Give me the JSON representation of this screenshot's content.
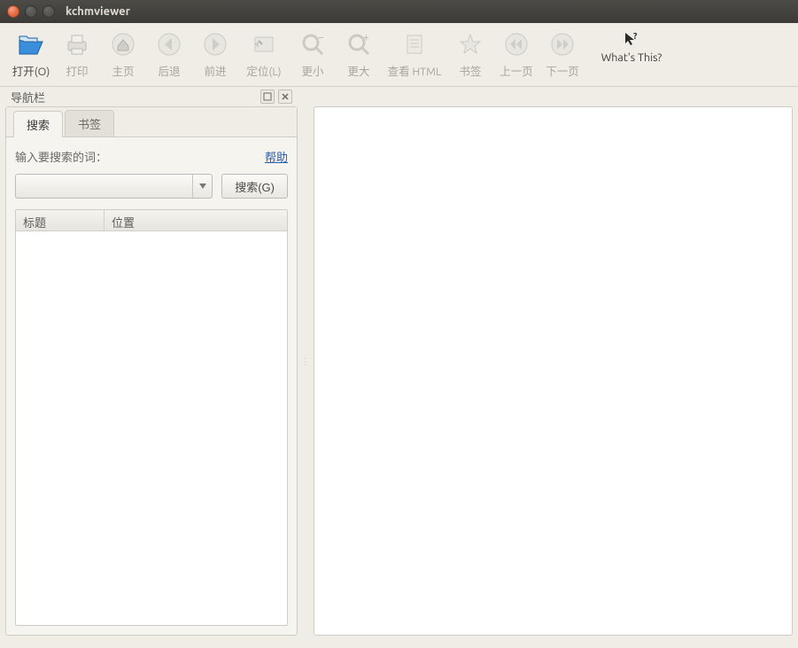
{
  "window": {
    "title": "kchmviewer"
  },
  "toolbar": {
    "open": "打开(O)",
    "print": "打印",
    "home": "主页",
    "back": "后退",
    "forward": "前进",
    "locate": "定位(L)",
    "zoom_out": "更小",
    "zoom_in": "更大",
    "view_html": "查看 HTML",
    "bookmark": "书签",
    "prev_page": "上一页",
    "next_page": "下一页",
    "whats_this": "What's This?"
  },
  "nav": {
    "panel_title": "导航栏",
    "tabs": {
      "search": "搜索",
      "bookmark": "书签"
    },
    "search": {
      "prompt": "输入要搜索的词：",
      "help": "帮助",
      "go_button": "搜索(G)",
      "columns": {
        "title": "标题",
        "location": "位置"
      }
    }
  }
}
